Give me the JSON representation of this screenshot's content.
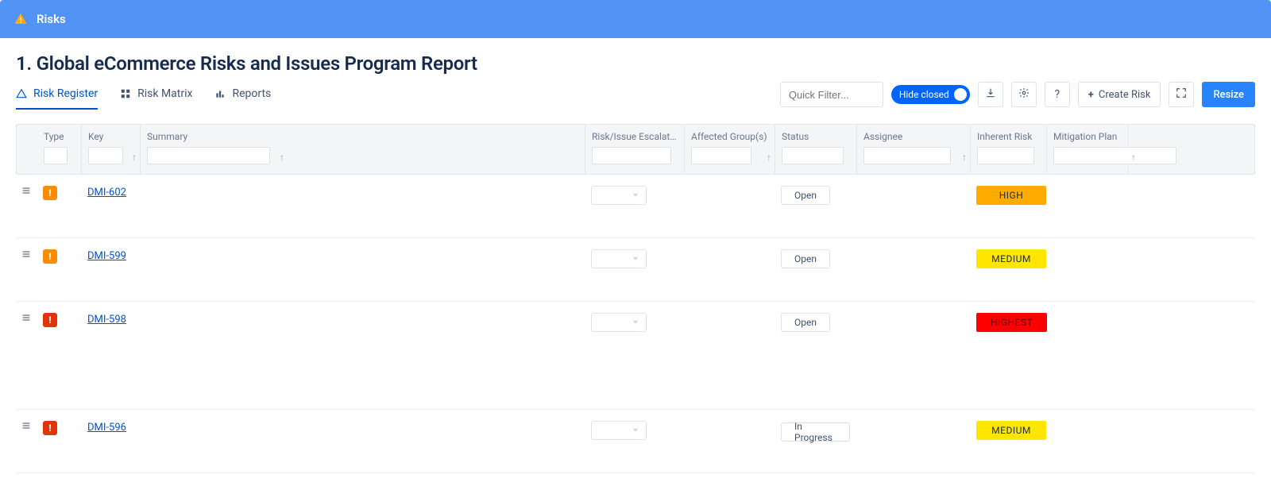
{
  "header": {
    "title": "Risks"
  },
  "page": {
    "title": "1. Global eCommerce Risks and Issues Program Report"
  },
  "tabs": {
    "register": "Risk Register",
    "matrix": "Risk Matrix",
    "reports": "Reports"
  },
  "toolbar": {
    "quick_filter_placeholder": "Quick Filter...",
    "hide_closed": "Hide closed",
    "create_risk": "Create Risk",
    "resize": "Resize"
  },
  "columns": {
    "type": "Type",
    "key": "Key",
    "summary": "Summary",
    "escalation": "Risk/Issue Escalation Lev",
    "affected": "Affected Group(s)",
    "status": "Status",
    "assignee": "Assignee",
    "inherent": "Inherent Risk",
    "mitigation": "Mitigation Plan"
  },
  "rows": [
    {
      "type_color": "high",
      "key": "DMI-602",
      "status": "Open",
      "risk": "HIGH"
    },
    {
      "type_color": "high",
      "key": "DMI-599",
      "status": "Open",
      "risk": "MEDIUM"
    },
    {
      "type_color": "crit",
      "key": "DMI-598",
      "status": "Open",
      "risk": "HIGHEST"
    },
    {
      "type_color": "crit",
      "key": "DMI-596",
      "status": "In Progress",
      "risk": "MEDIUM"
    }
  ]
}
